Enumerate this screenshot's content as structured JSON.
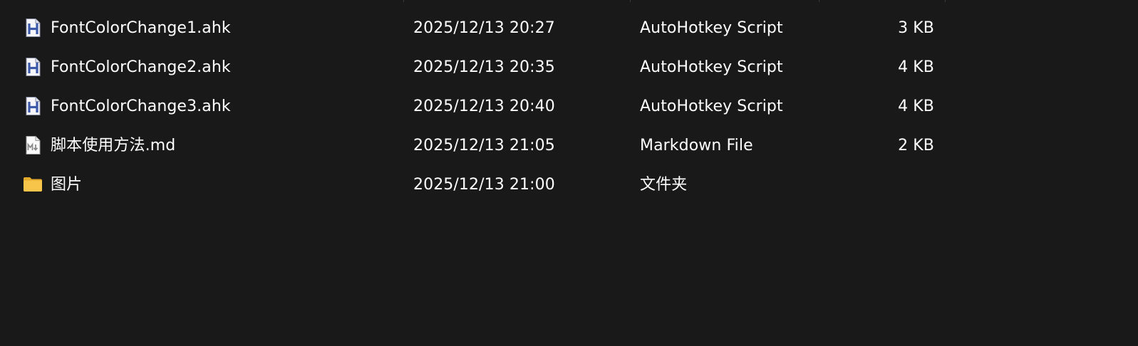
{
  "files": [
    {
      "icon": "ahk-script-icon",
      "name": "FontColorChange1.ahk",
      "modified": "2025/12/13 20:27",
      "type": "AutoHotkey Script",
      "size": "3 KB"
    },
    {
      "icon": "ahk-script-icon",
      "name": "FontColorChange2.ahk",
      "modified": "2025/12/13 20:35",
      "type": "AutoHotkey Script",
      "size": "4 KB"
    },
    {
      "icon": "ahk-script-icon",
      "name": "FontColorChange3.ahk",
      "modified": "2025/12/13 20:40",
      "type": "AutoHotkey Script",
      "size": "4 KB"
    },
    {
      "icon": "markdown-file-icon",
      "name": "脚本使用方法.md",
      "modified": "2025/12/13 21:05",
      "type": "Markdown File",
      "size": "2 KB"
    },
    {
      "icon": "folder-icon",
      "name": "图片",
      "modified": "2025/12/13 21:00",
      "type": "文件夹",
      "size": ""
    }
  ],
  "colors": {
    "background": "#191919",
    "text": "#ffffff",
    "ahk_letter": "#3d5aa8",
    "folder": "#f6c54a"
  }
}
